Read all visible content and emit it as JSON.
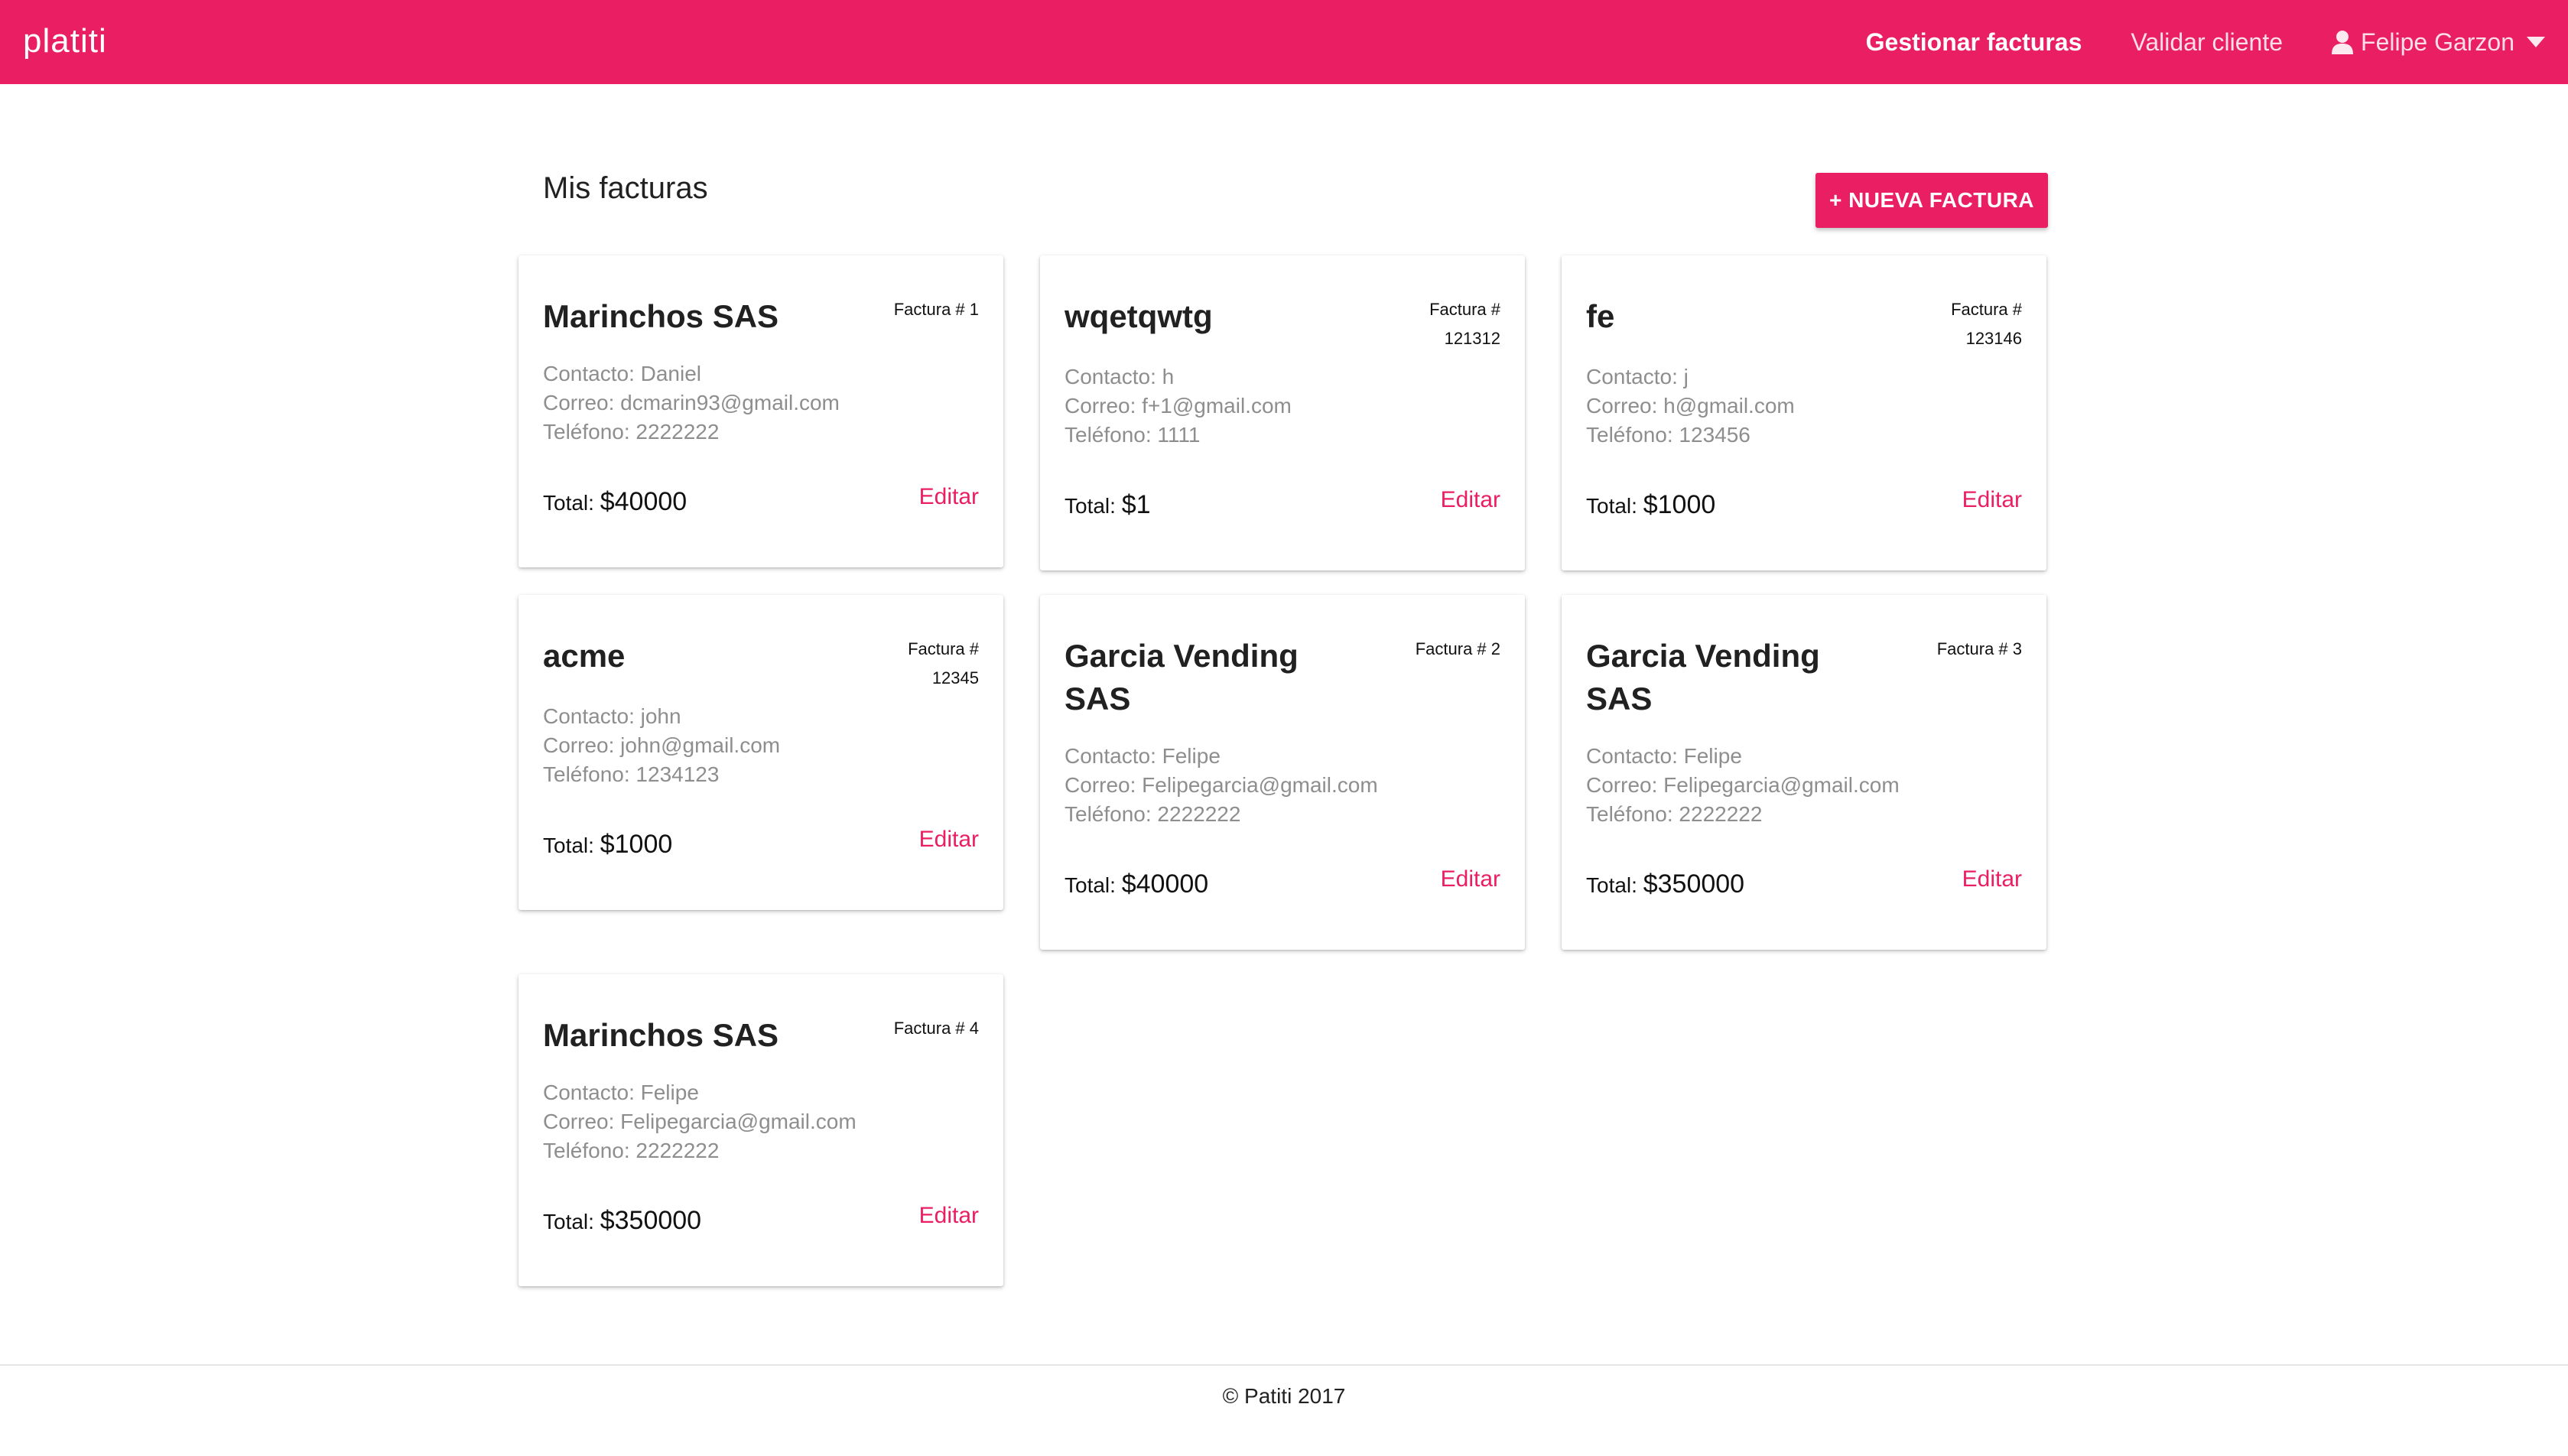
{
  "navbar": {
    "brand": "platiti",
    "links": [
      "Gestionar facturas",
      "Validar cliente"
    ],
    "user_name": "Felipe Garzon"
  },
  "main": {
    "title": "Mis facturas",
    "new_button_label": "+ NUEVA FACTURA"
  },
  "cards": [
    {
      "name": "Marinchos SAS",
      "number": "Factura # 1",
      "contact": "Contacto: Daniel",
      "email": "Correo: dcmarin93@gmail.com",
      "phone": "Teléfono: 2222222",
      "total_label": "Total:",
      "total": "$40000",
      "edit": "Editar"
    },
    {
      "name": "wqetqwtg",
      "number": "Factura # 121312",
      "contact": "Contacto: h",
      "email": "Correo: f+1@gmail.com",
      "phone": "Teléfono: 1111",
      "total_label": "Total:",
      "total": "$1",
      "edit": "Editar"
    },
    {
      "name": "fe",
      "number": "Factura # 123146",
      "contact": "Contacto: j",
      "email": "Correo: h@gmail.com",
      "phone": "Teléfono: 123456",
      "total_label": "Total:",
      "total": "$1000",
      "edit": "Editar"
    },
    {
      "name": "acme",
      "number": "Factura # 12345",
      "contact": "Contacto: john",
      "email": "Correo: john@gmail.com",
      "phone": "Teléfono: 1234123",
      "total_label": "Total:",
      "total": "$1000",
      "edit": "Editar"
    },
    {
      "name": "Garcia Vending SAS",
      "number": "Factura # 2",
      "contact": "Contacto: Felipe",
      "email": "Correo: Felipegarcia@gmail.com",
      "phone": "Teléfono: 2222222",
      "total_label": "Total:",
      "total": "$40000",
      "edit": "Editar"
    },
    {
      "name": "Garcia Vending SAS",
      "number": "Factura # 3",
      "contact": "Contacto: Felipe",
      "email": "Correo: Felipegarcia@gmail.com",
      "phone": "Teléfono: 2222222",
      "total_label": "Total:",
      "total": "$350000",
      "edit": "Editar"
    },
    {
      "name": "Marinchos SAS",
      "number": "Factura # 4",
      "contact": "Contacto: Felipe",
      "email": "Correo: Felipegarcia@gmail.com",
      "phone": "Teléfono: 2222222",
      "total_label": "Total:",
      "total": "$350000",
      "edit": "Editar"
    }
  ],
  "footer": {
    "copyright": "© Patiti 2017"
  },
  "colors": {
    "accent": "#e91e63",
    "muted_text": "#8e8e8e"
  },
  "icons": {
    "user": "user-icon",
    "dropdown": "caret-down-icon"
  }
}
